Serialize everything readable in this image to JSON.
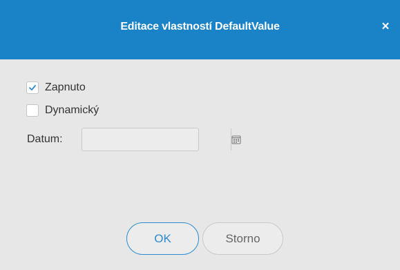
{
  "dialog": {
    "title": "Editace vlastností DefaultValue",
    "close_glyph": "×"
  },
  "options": {
    "enabled": {
      "label": "Zapnuto",
      "checked": true
    },
    "dynamic": {
      "label": "Dynamický",
      "checked": false
    }
  },
  "date": {
    "label": "Datum:",
    "value": "",
    "picker_icon": "calendar-icon"
  },
  "buttons": {
    "ok": "OK",
    "cancel": "Storno"
  },
  "colors": {
    "titlebar": "#1a82c6",
    "accent": "#2a8bd0",
    "background": "#e7e7e7"
  }
}
